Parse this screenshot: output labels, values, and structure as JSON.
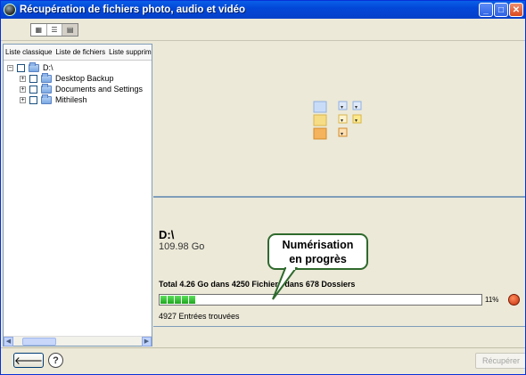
{
  "window": {
    "title": "Récupération de fichiers photo, audio et vidéo"
  },
  "tabs": [
    "Liste classique",
    "Liste de fichiers",
    "Liste supprimé"
  ],
  "tree": [
    {
      "label": "D:\\",
      "expander": "−"
    },
    {
      "label": "Desktop Backup",
      "expander": "+"
    },
    {
      "label": "Documents and Settings",
      "expander": "+"
    },
    {
      "label": "Mithilesh",
      "expander": "+"
    }
  ],
  "scan": {
    "drive_name": "D:\\",
    "drive_size": "109.98 Go",
    "total_text": "Total 4.26 Go dans 4250 Fichiers dans 678 Dossiers",
    "progress_percent": 11,
    "progress_label": "11%",
    "entries_found": "4927 Entrées trouvées"
  },
  "callout": {
    "line1": "Numérisation",
    "line2": "en progrès"
  },
  "buttons": {
    "back": "🡐",
    "help": "?",
    "recover": "Récupérer"
  },
  "colors": {
    "accent": "#0347d8",
    "progress": "#1ea51e",
    "callout_border": "#2f6a2d"
  }
}
